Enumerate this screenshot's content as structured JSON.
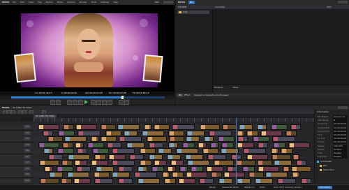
{
  "player": {
    "app": "EDIUS",
    "menu": [
      "File",
      "Edit",
      "View",
      "Clip",
      "Marker",
      "Mode",
      "Capture",
      "Render",
      "Tools",
      "Settings",
      "Help"
    ],
    "mode_badge": "PLR",
    "timecodes": {
      "cur": "Cur 00:01:46;13",
      "in": "In 00:00:00;00",
      "out": "Out 00:00:07;28",
      "dur": "Dur 00:00:07;28",
      "ttl": "Ttl 00:01:48;24"
    }
  },
  "bin": {
    "app": "EDIUS",
    "tab_label": "Bin",
    "path_label": "root (0/0)",
    "folder_header": "FOLDER",
    "root_folder": "root",
    "zoom": "32%",
    "property_col": "Property",
    "value_col": "Value",
    "bottom_tabs": [
      "Bin",
      "Effect",
      "Sequence marker",
      "Source Browser"
    ]
  },
  "timeline": {
    "app": "EDIUS",
    "project_name": "SK 1080 HD 30fps",
    "sequence_tab": "SK 1080 HD 30fps",
    "tracks": [
      "V1",
      "V2",
      "V3",
      "V4",
      "V5",
      "V6",
      "V7",
      "V8",
      "V9",
      "V10"
    ],
    "left_labels": [
      "1",
      "2",
      "3",
      "4",
      "5",
      "6",
      "7",
      "8",
      "9",
      "10",
      "11",
      "12",
      "13",
      "14",
      "15",
      "16"
    ]
  },
  "info_panel": {
    "title": "Information",
    "rows": [
      {
        "k": "File Name",
        "v": "Sequence1"
      },
      {
        "k": "Clip Name",
        "v": "B"
      },
      {
        "k": "Source In",
        "v": "00:00:00;00"
      },
      {
        "k": "Source Out",
        "v": "00:00:00;00"
      },
      {
        "k": "Source Dur",
        "v": "00:00:00;00"
      },
      {
        "k": "TL In",
        "v": "00:00:00;00"
      },
      {
        "k": "TL Out",
        "v": "00:00:00;00"
      },
      {
        "k": "TL Dur",
        "v": "00:00:00;00"
      },
      {
        "k": "Speed",
        "v": "100.00%"
      },
      {
        "k": "Freeze",
        "v": "Disable"
      },
      {
        "k": "Time",
        "v": "Disable"
      },
      {
        "k": "Layouter",
        "v": "Disable"
      }
    ],
    "tree": [
      "Composite",
      "Blur",
      "Resolution"
    ]
  },
  "status": {
    "pause": "Pause",
    "mode": "Overwrite Mode",
    "ripple": "Ripple On",
    "audio": "Mute",
    "disk": "Disk: 97% is being used(C:)",
    "badge": "Information"
  },
  "colors": {
    "timeline_bg": "#262629",
    "playhead": "#3a7bd5",
    "accent": "#2f7fd8"
  }
}
